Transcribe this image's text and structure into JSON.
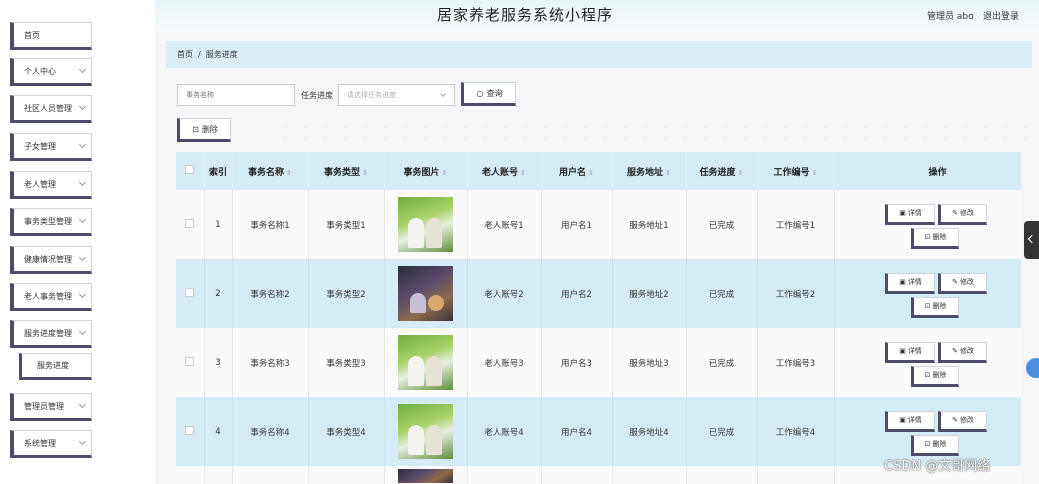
{
  "header": {
    "title": "居家养老服务系统小程序",
    "admin_label": "管理员 abo",
    "logout": "退出登录"
  },
  "sidebar": {
    "items": [
      {
        "label": "首页",
        "has_chevron": false
      },
      {
        "label": "个人中心",
        "has_chevron": true
      },
      {
        "label": "社区人员管理",
        "has_chevron": true
      },
      {
        "label": "子女管理",
        "has_chevron": true
      },
      {
        "label": "老人管理",
        "has_chevron": true
      },
      {
        "label": "事务类型管理",
        "has_chevron": true
      },
      {
        "label": "健康情况管理",
        "has_chevron": true
      },
      {
        "label": "老人事务管理",
        "has_chevron": true
      },
      {
        "label": "服务进度管理",
        "has_chevron": true
      },
      {
        "label": "服务进度",
        "has_chevron": false
      },
      {
        "label": "管理员管理",
        "has_chevron": true
      },
      {
        "label": "系统管理",
        "has_chevron": true
      }
    ]
  },
  "breadcrumb": {
    "home": "首页",
    "separator": "/",
    "current": "服务进度"
  },
  "search": {
    "name_placeholder": "事务名称",
    "status_label": "任务进度",
    "status_placeholder": "请选择任务进度",
    "query_button": "查询",
    "delete_button": "删除"
  },
  "table": {
    "headers": [
      "索引",
      "事务名称",
      "事务类型",
      "事务图片",
      "老人账号",
      "用户名",
      "服务地址",
      "任务进度",
      "工作编号",
      "操作"
    ],
    "rows": [
      {
        "index": "1",
        "name": "事务名称1",
        "type": "事务类型1",
        "image": "green",
        "account": "老人账号1",
        "username": "用户名1",
        "address": "服务地址1",
        "status": "已完成",
        "job_no": "工作编号1"
      },
      {
        "index": "2",
        "name": "事务名称2",
        "type": "事务类型2",
        "image": "dark",
        "account": "老人账号2",
        "username": "用户名2",
        "address": "服务地址2",
        "status": "已完成",
        "job_no": "工作编号2"
      },
      {
        "index": "3",
        "name": "事务名称3",
        "type": "事务类型3",
        "image": "green",
        "account": "老人账号3",
        "username": "用户名3",
        "address": "服务地址3",
        "status": "已完成",
        "job_no": "工作编号3"
      },
      {
        "index": "4",
        "name": "事务名称4",
        "type": "事务类型4",
        "image": "green",
        "account": "老人账号4",
        "username": "用户名4",
        "address": "服务地址4",
        "status": "已完成",
        "job_no": "工作编号4"
      }
    ],
    "actions": {
      "detail": "详情",
      "edit": "修改",
      "delete": "删除"
    }
  },
  "watermark": "CSDN @文哥网络",
  "colors": {
    "accent_dark": "#4d4d6a",
    "header_blue": "#d4ecf7",
    "float_blue": "#4a8fe0"
  }
}
